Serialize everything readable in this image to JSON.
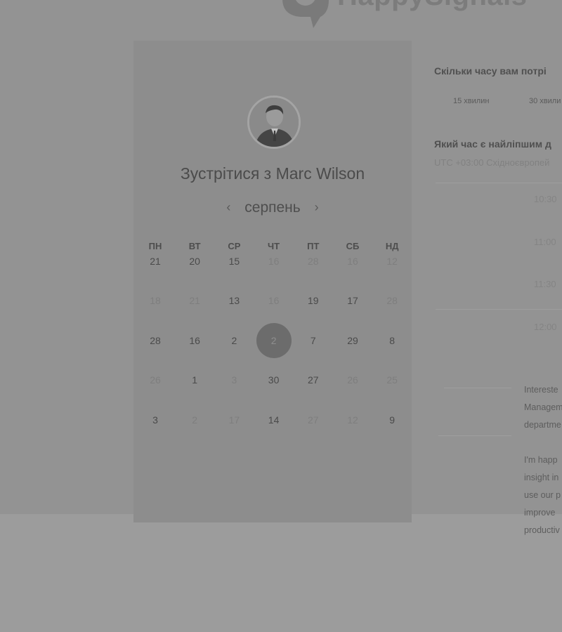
{
  "brand": {
    "logo_text": "HappySignals"
  },
  "calendar": {
    "title": "Зустрітися з Marc Wilson",
    "month": "серпень",
    "prev_icon": "‹",
    "next_icon": "›",
    "weekdays": [
      "ПН",
      "ВТ",
      "СР",
      "ЧТ",
      "ПТ",
      "СБ",
      "НД"
    ],
    "weeks": [
      [
        {
          "d": "21",
          "s": "on"
        },
        {
          "d": "20",
          "s": "on"
        },
        {
          "d": "15",
          "s": "on"
        },
        {
          "d": "16",
          "s": "off"
        },
        {
          "d": "28",
          "s": "off"
        },
        {
          "d": "16",
          "s": "off"
        },
        {
          "d": "12",
          "s": "off"
        }
      ],
      [
        {
          "d": "18",
          "s": "off"
        },
        {
          "d": "21",
          "s": "off"
        },
        {
          "d": "13",
          "s": "on"
        },
        {
          "d": "16",
          "s": "off"
        },
        {
          "d": "19",
          "s": "on"
        },
        {
          "d": "17",
          "s": "on"
        },
        {
          "d": "28",
          "s": "off"
        }
      ],
      [
        {
          "d": "28",
          "s": "on"
        },
        {
          "d": "16",
          "s": "on"
        },
        {
          "d": "2",
          "s": "on"
        },
        {
          "d": "2",
          "s": "sel"
        },
        {
          "d": "7",
          "s": "on"
        },
        {
          "d": "29",
          "s": "on"
        },
        {
          "d": "8",
          "s": "on"
        }
      ],
      [
        {
          "d": "26",
          "s": "off"
        },
        {
          "d": "1",
          "s": "on"
        },
        {
          "d": "3",
          "s": "off"
        },
        {
          "d": "30",
          "s": "on"
        },
        {
          "d": "27",
          "s": "on"
        },
        {
          "d": "26",
          "s": "off"
        },
        {
          "d": "25",
          "s": "off"
        }
      ],
      [
        {
          "d": "3",
          "s": "on"
        },
        {
          "d": "2",
          "s": "off"
        },
        {
          "d": "17",
          "s": "off"
        },
        {
          "d": "14",
          "s": "on"
        },
        {
          "d": "27",
          "s": "off"
        },
        {
          "d": "12",
          "s": "off"
        },
        {
          "d": "9",
          "s": "on"
        }
      ]
    ]
  },
  "booking": {
    "duration_question": "Скільки часу вам потрі",
    "durations": [
      "15 хвилин",
      "30 хвили"
    ],
    "time_question": "Який час є найліпшим д",
    "timezone": "UTC +03:00 Східноєвропей",
    "slots": [
      "10:30",
      "11:00",
      "11:30",
      "12:00"
    ],
    "description_1": [
      "Intereste",
      "Managem",
      "departme"
    ],
    "description_2": [
      "I'm happ",
      "insight in",
      "use our p",
      "improve",
      "productiv"
    ]
  }
}
